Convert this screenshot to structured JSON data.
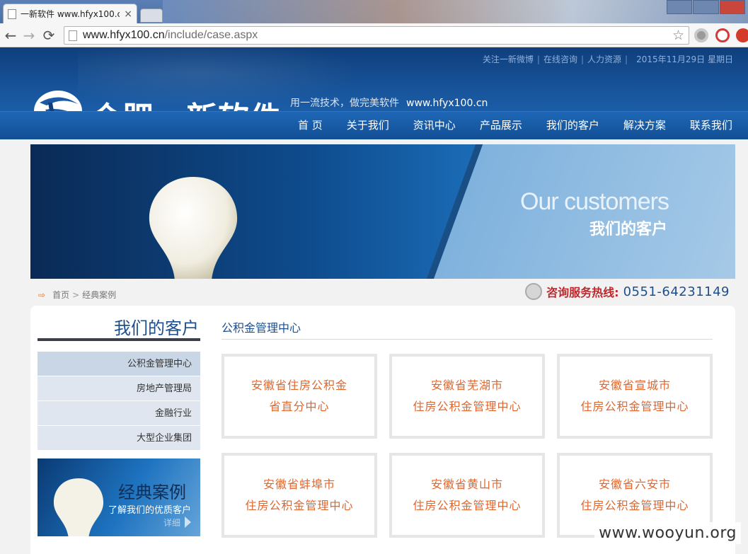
{
  "browser": {
    "tab_title": "一新软件 www.hfyx100.c",
    "tab_close": "×",
    "back": "←",
    "forward": "→",
    "reload": "⟳",
    "url_host": "www.hfyx100.cn",
    "url_path": "/include/case.aspx",
    "star": "☆"
  },
  "header": {
    "top_links": [
      "关注一新微博",
      "在线咨询",
      "人力资源"
    ],
    "separator": "|",
    "date": "2015年11月29日  星期日",
    "logo_text": "合肥一新软件",
    "slogan": "用一流技术，做完美软件",
    "slogan_site": "www.hfyx100.cn",
    "nav": [
      "首 页",
      "关于我们",
      "资讯中心",
      "产品展示",
      "我们的客户",
      "解决方案",
      "联系我们"
    ]
  },
  "banner": {
    "en": "Our customers",
    "cn": "我们的客户"
  },
  "breadcrumb": {
    "home": "首页",
    "sep": ">",
    "current": "经典案例"
  },
  "hotline": {
    "label": "咨询服务热线:",
    "number": "0551-64231149"
  },
  "sidebar": {
    "title": "我们的客户",
    "items": [
      "公积金管理中心",
      "房地产管理局",
      "金融行业",
      "大型企业集团"
    ],
    "promo_title": "经典案例",
    "promo_sub": "了解我们的优质客户",
    "promo_more": "详细"
  },
  "main": {
    "section_title": "公积金管理中心",
    "cards": [
      {
        "line1": "安徽省住房公积金",
        "line2": "省直分中心"
      },
      {
        "line1": "安徽省芜湖市",
        "line2": "住房公积金管理中心"
      },
      {
        "line1": "安徽省宣城市",
        "line2": "住房公积金管理中心"
      },
      {
        "line1": "安徽省蚌埠市",
        "line2": "住房公积金管理中心"
      },
      {
        "line1": "安徽省黄山市",
        "line2": "住房公积金管理中心"
      },
      {
        "line1": "安徽省六安市",
        "line2": "住房公积金管理中心"
      }
    ]
  },
  "watermark": "www.wooyun.org",
  "colors": {
    "brand_blue": "#1d4f8f",
    "card_text": "#e0662d",
    "hotline_red": "#c0272d"
  }
}
